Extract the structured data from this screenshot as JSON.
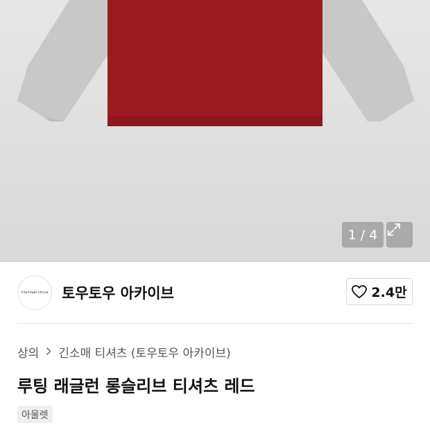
{
  "gallery": {
    "counter": "1 / 4",
    "expand_icon": "expand-arrows-icon",
    "colors": {
      "body": "#9b1b20",
      "sleeve": "#c9c9c9",
      "background": "#dedede"
    }
  },
  "shop": {
    "logo_text": "towtowarchive",
    "name": "토우토우 아카이브",
    "like_icon": "heart-outline-icon",
    "likes": "2.4만"
  },
  "breadcrumb": {
    "items": [
      "상의",
      "긴소매 티셔츠 (토우토우 아카이브)"
    ],
    "separator_icon": "chevron-right-icon"
  },
  "product": {
    "title": "루팅 래글런 롱슬리브 티셔츠 레드",
    "tag": "아울렛"
  }
}
